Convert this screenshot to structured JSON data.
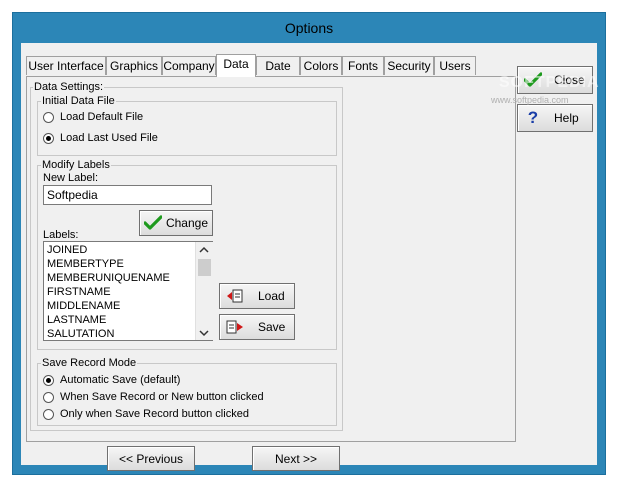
{
  "window": {
    "title": "Options"
  },
  "tabs": [
    {
      "label": "User Interface"
    },
    {
      "label": "Graphics"
    },
    {
      "label": "Company"
    },
    {
      "label": "Data"
    },
    {
      "label": "Date"
    },
    {
      "label": "Colors"
    },
    {
      "label": "Fonts"
    },
    {
      "label": "Security"
    },
    {
      "label": "Users"
    }
  ],
  "active_tab": "Data",
  "data_settings": {
    "legend": "Data Settings:",
    "initial_file": {
      "legend": "Initial Data File",
      "options": [
        "Load Default File",
        "Load Last Used File"
      ],
      "selected": "Load Last Used File"
    },
    "modify_labels": {
      "legend": "Modify Labels",
      "new_label_caption": "New Label:",
      "new_label_value": "Softpedia",
      "change_button": "Change",
      "labels_caption": "Labels:",
      "labels": [
        "JOINED",
        "MEMBERTYPE",
        "MEMBERUNIQUENAME",
        "FIRSTNAME",
        "MIDDLENAME",
        "LASTNAME",
        "SALUTATION"
      ],
      "load_button": "Load",
      "save_button": "Save"
    },
    "save_mode": {
      "legend": "Save Record Mode",
      "options": [
        "Automatic Save (default)",
        "When Save Record or New button clicked",
        "Only when Save Record button clicked"
      ],
      "selected": "Automatic Save (default)"
    }
  },
  "side_buttons": {
    "close": "Close",
    "help": "Help"
  },
  "nav_buttons": {
    "previous": "<< Previous",
    "next": "Next >>"
  },
  "watermark": {
    "text": "SOFTPEDIA",
    "url": "www.softpedia.com"
  },
  "colors": {
    "window_frame": "#2c86b7",
    "client": "#f0f0f0",
    "check_green": "#1e9a1e",
    "help_blue": "#1a3ea8",
    "arrow_red": "#d01818"
  }
}
